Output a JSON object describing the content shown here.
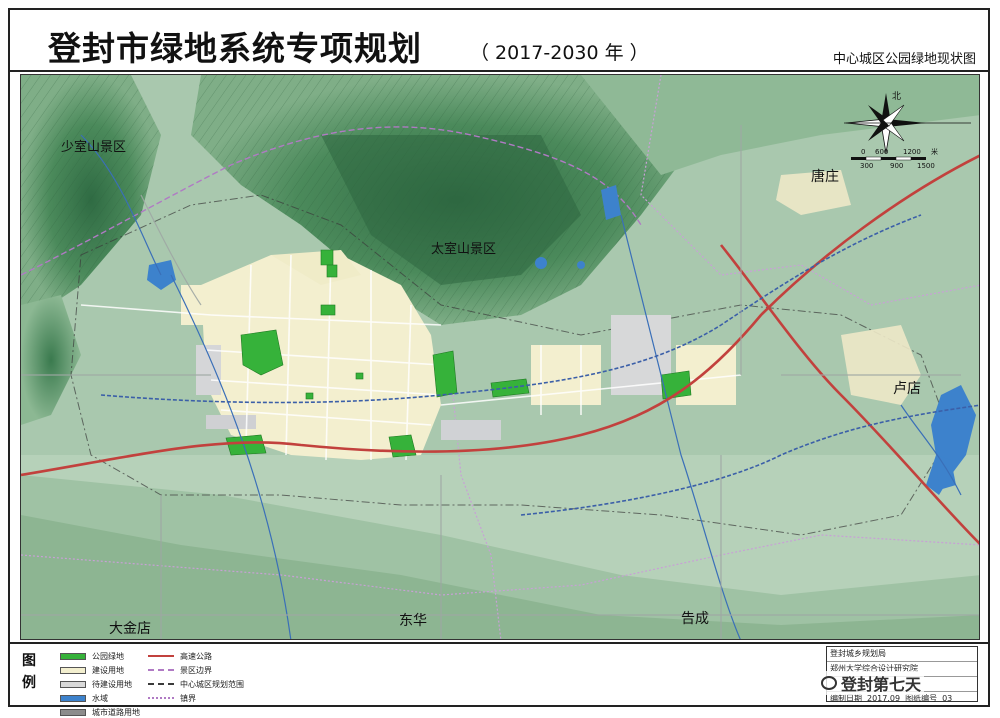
{
  "header": {
    "title": "登封市绿地系统专项规划",
    "years": "（ 2017-2030 年 ）",
    "subtitle": "中心城区公园绿地现状图"
  },
  "map": {
    "place_labels": {
      "shaoshi": "少室山景区",
      "taishi": "太室山景区",
      "tangzhuang": "唐庄",
      "ludian": "卢店",
      "dajindian": "大金店",
      "donghua": "东华",
      "gaocheng": "告成"
    },
    "north_label": "北",
    "scale_ticks": [
      "0",
      "300",
      "600",
      "900",
      "1200",
      "1500"
    ],
    "scale_unit": "米",
    "colors": {
      "mountain_dark": "#3f7d52",
      "mountain_mid": "#5f9a6c",
      "plain": "#a9c8ae",
      "plain_light": "#bed6c1",
      "urban": "#f3efcf",
      "park": "#36b23a",
      "water": "#3d82cc",
      "highway": "#c2413d",
      "road": "#e8e8e8",
      "rail": "#3b5fa8",
      "boundary": "#b07ac4"
    }
  },
  "legend": {
    "heading": "图例",
    "items": [
      {
        "label": "公园绿地",
        "color": "#36b23a",
        "kind": "fill"
      },
      {
        "label": "建设用地",
        "color": "#f3efcf",
        "kind": "fill"
      },
      {
        "label": "待建设用地",
        "color": "#d9d9d9",
        "kind": "fill"
      },
      {
        "label": "水域",
        "color": "#3d82cc",
        "kind": "fill"
      },
      {
        "label": "城市道路用地",
        "color": "#8c8c8c",
        "kind": "fill"
      },
      {
        "label": "高速公路",
        "color": "#c2413d",
        "kind": "line"
      },
      {
        "label": "景区边界",
        "color": "#b07ac4",
        "kind": "dash"
      },
      {
        "label": "中心城区规划范围",
        "color": "#3b3b3b",
        "kind": "dashdot"
      },
      {
        "label": "镇界",
        "color": "#b07ac4",
        "kind": "dot"
      }
    ]
  },
  "info": {
    "org": "登封城乡规划局",
    "org2": "郑州大学综合设计研究院",
    "date_label": "编制日期",
    "date_value": "2017.09",
    "sheet_label": "图纸编号",
    "sheet_value": "03"
  },
  "watermark": "登封第七天"
}
